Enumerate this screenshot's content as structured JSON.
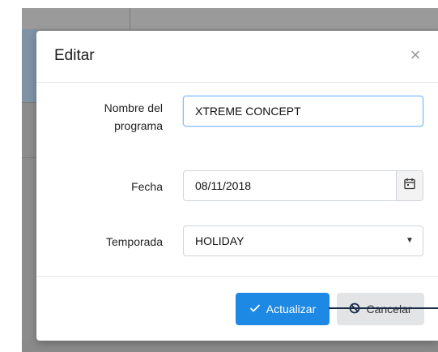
{
  "modal": {
    "title": "Editar",
    "close_glyph": "×",
    "fields": {
      "program_name": {
        "label_line1": "Nombre del",
        "label_line2": "programa",
        "value": "XTREME CONCEPT"
      },
      "date": {
        "label": "Fecha",
        "value": "08/11/2018",
        "icon": "calendar-icon"
      },
      "season": {
        "label": "Temporada",
        "value": "HOLIDAY",
        "icon": "chevron-down-icon"
      }
    },
    "buttons": {
      "update_label": "Actualizar",
      "update_icon": "check-icon",
      "cancel_label": "Cancelar",
      "cancel_icon": "ban-icon"
    }
  },
  "colors": {
    "primary": "#1e88e5",
    "secondary_button": "#e2e4e6",
    "backdrop": "#8c8c8c",
    "focus_border": "#80bdff"
  }
}
